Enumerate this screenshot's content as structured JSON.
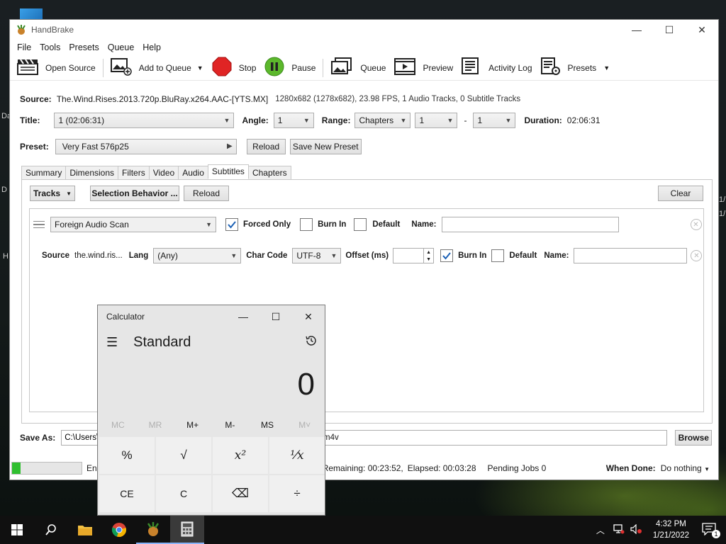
{
  "desktop": {
    "edge_texts": [
      "Da",
      "D",
      "H",
      "1/",
      "1/"
    ]
  },
  "handbrake": {
    "title": "HandBrake",
    "menu": [
      "File",
      "Tools",
      "Presets",
      "Queue",
      "Help"
    ],
    "toolbar": {
      "open_source": "Open Source",
      "add_to_queue": "Add to Queue",
      "stop": "Stop",
      "pause": "Pause",
      "queue": "Queue",
      "preview": "Preview",
      "activity_log": "Activity Log",
      "presets": "Presets"
    },
    "source": {
      "label": "Source:",
      "name": "The.Wind.Rises.2013.720p.BluRay.x264.AAC-[YTS.MX]",
      "info": "1280x682 (1278x682), 23.98 FPS, 1 Audio Tracks, 0 Subtitle Tracks"
    },
    "title_row": {
      "title_label": "Title:",
      "title_value": "1  (02:06:31)",
      "angle_label": "Angle:",
      "angle_value": "1",
      "range_label": "Range:",
      "range_value": "Chapters",
      "range_start": "1",
      "range_dash": "-",
      "range_end": "1",
      "duration_label": "Duration:",
      "duration_value": "02:06:31"
    },
    "preset": {
      "label": "Preset:",
      "value": "Very Fast 576p25",
      "reload": "Reload",
      "save_new": "Save New Preset"
    },
    "tabs": [
      "Summary",
      "Dimensions",
      "Filters",
      "Video",
      "Audio",
      "Subtitles",
      "Chapters"
    ],
    "active_tab": "Subtitles",
    "subtitles": {
      "tracks_btn": "Tracks",
      "selection_behavior_btn": "Selection Behavior ...",
      "reload_btn": "Reload",
      "clear_btn": "Clear",
      "row1": {
        "track": "Foreign Audio Scan",
        "forced_only": "Forced Only",
        "forced_only_checked": true,
        "burn_in": "Burn In",
        "burn_in_checked": false,
        "default": "Default",
        "default_checked": false,
        "name_label": "Name:",
        "name_value": ""
      },
      "row2": {
        "source_label": "Source",
        "source_value": "the.wind.ris...",
        "lang_label": "Lang",
        "lang_value": "(Any)",
        "charcode_label": "Char Code",
        "charcode_value": "UTF-8",
        "offset_label": "Offset (ms)",
        "offset_value": "",
        "burn_in": "Burn In",
        "burn_in_checked": true,
        "default": "Default",
        "default_checked": false,
        "name_label": "Name:",
        "name_value": ""
      }
    },
    "save_as": {
      "label": "Save As:",
      "path_visible_start": "C:\\Users\\V",
      "path_visible_end": "m4v",
      "browse": "Browse"
    },
    "status": {
      "progress": 0.12,
      "encoding_prefix": "Enc",
      "remaining": "Remaining: 00:23:52,",
      "elapsed": "Elapsed: 00:03:28",
      "pending": "Pending Jobs 0",
      "when_done_label": "When Done:",
      "when_done_value": "Do nothing"
    }
  },
  "calculator": {
    "title": "Calculator",
    "mode": "Standard",
    "display": "0",
    "memory": [
      "MC",
      "MR",
      "M+",
      "M-",
      "MS",
      "M˅"
    ],
    "memory_enabled": [
      false,
      false,
      true,
      true,
      true,
      false
    ],
    "keys": [
      "%",
      "√",
      "x²",
      "¹⁄x",
      "CE",
      "C",
      "⌫",
      "÷"
    ]
  },
  "taskbar": {
    "time": "4:32 PM",
    "date": "1/21/2022",
    "notification_count": "1"
  },
  "colors": {
    "stop_red": "#e02424",
    "pause_green": "#5cb82c",
    "progress_green": "#2fbf2f",
    "check_blue": "#1a5fb4"
  }
}
